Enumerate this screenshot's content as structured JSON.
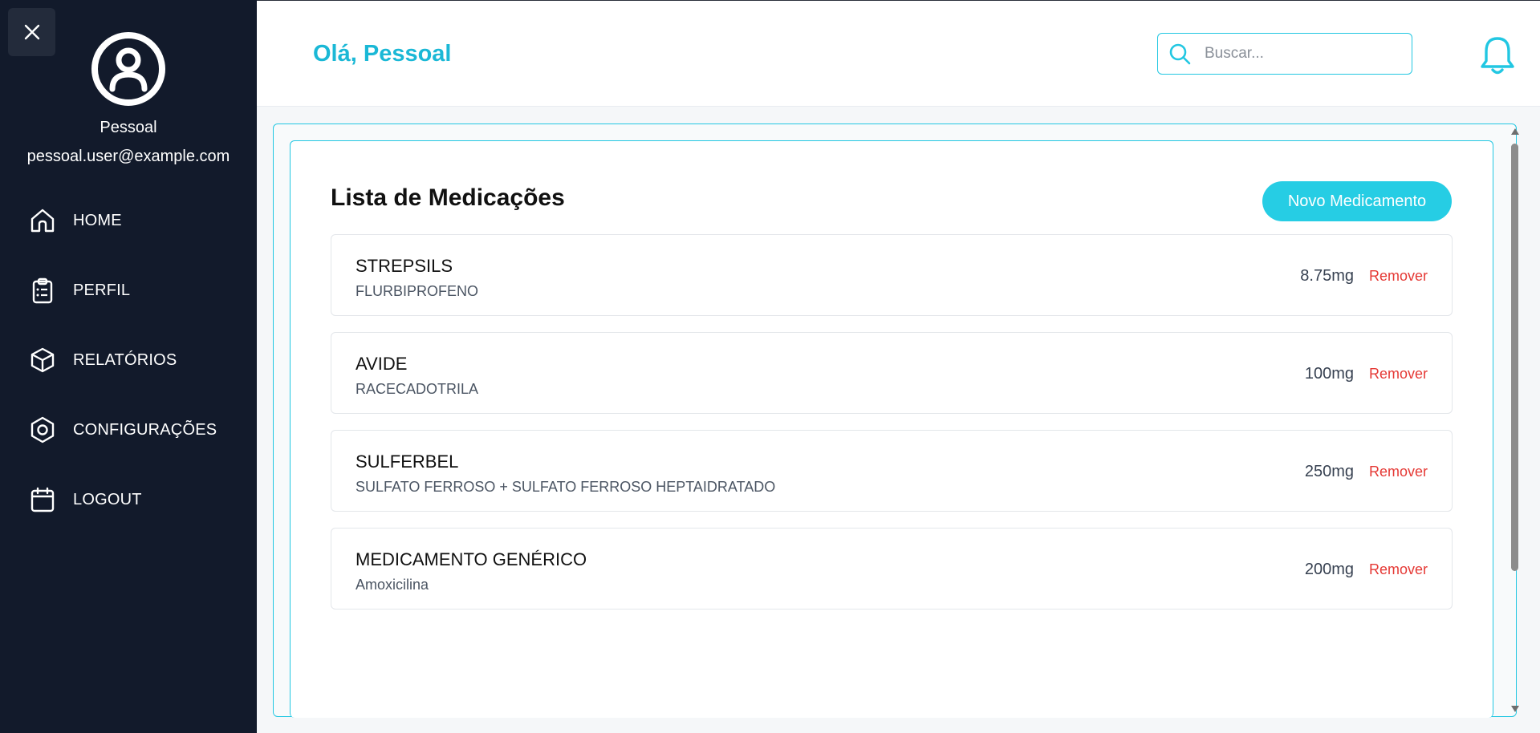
{
  "sidebar": {
    "user": {
      "name": "Pessoal",
      "email": "pessoal.user@example.com"
    },
    "items": [
      {
        "label": "HOME",
        "icon": "home-icon"
      },
      {
        "label": "PERFIL",
        "icon": "clipboard-icon"
      },
      {
        "label": "RELATÓRIOS",
        "icon": "box-icon"
      },
      {
        "label": "CONFIGURAÇÕES",
        "icon": "hexagon-settings-icon"
      },
      {
        "label": "LOGOUT",
        "icon": "calendar-icon"
      }
    ]
  },
  "header": {
    "greeting": "Olá, Pessoal",
    "search_placeholder": "Buscar..."
  },
  "main": {
    "title": "Lista de Medicações",
    "new_button": "Novo Medicamento",
    "remove_label": "Remover",
    "medications": [
      {
        "name": "STREPSILS",
        "substance": "FLURBIPROFENO",
        "dose": "8.75mg"
      },
      {
        "name": "AVIDE",
        "substance": "RACECADOTRILA",
        "dose": "100mg"
      },
      {
        "name": "SULFERBEL",
        "substance": "SULFATO FERROSO + SULFATO FERROSO HEPTAIDRATADO",
        "dose": "250mg"
      },
      {
        "name": "MEDICAMENTO GENÉRICO",
        "substance": "Amoxicilina",
        "dose": "200mg"
      }
    ]
  },
  "colors": {
    "sidebar_bg": "#121a2b",
    "accent": "#22c7e2",
    "danger": "#e53935"
  }
}
